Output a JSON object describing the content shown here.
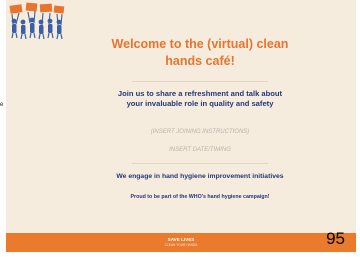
{
  "edge_fragment": "e",
  "poster": {
    "title": "Welcome to the (virtual) clean hands café!",
    "invite": "Join us to share a refreshment and talk about your invaluable role in quality and safety",
    "joining_instructions": "(INSERT JOINING INSTRUCTIONS)",
    "date_timing": "INSERT DATE/TIMING",
    "engage": "We engage in hand hygiene improvement initiatives",
    "proud": "Proud to be part of the WHO's hand hygiene campaign!",
    "footer_main": "SAVE LIVES",
    "footer_sub": "CLEAN YOUR HANDS"
  },
  "page_number": "95",
  "colors": {
    "background": "#f6ecdd",
    "title": "#e8742e",
    "body_text": "#243878",
    "footer": "#ea7a2c",
    "instruction_text": "#b9b2ab"
  },
  "logo_icon": "people-holding-banners-icon"
}
